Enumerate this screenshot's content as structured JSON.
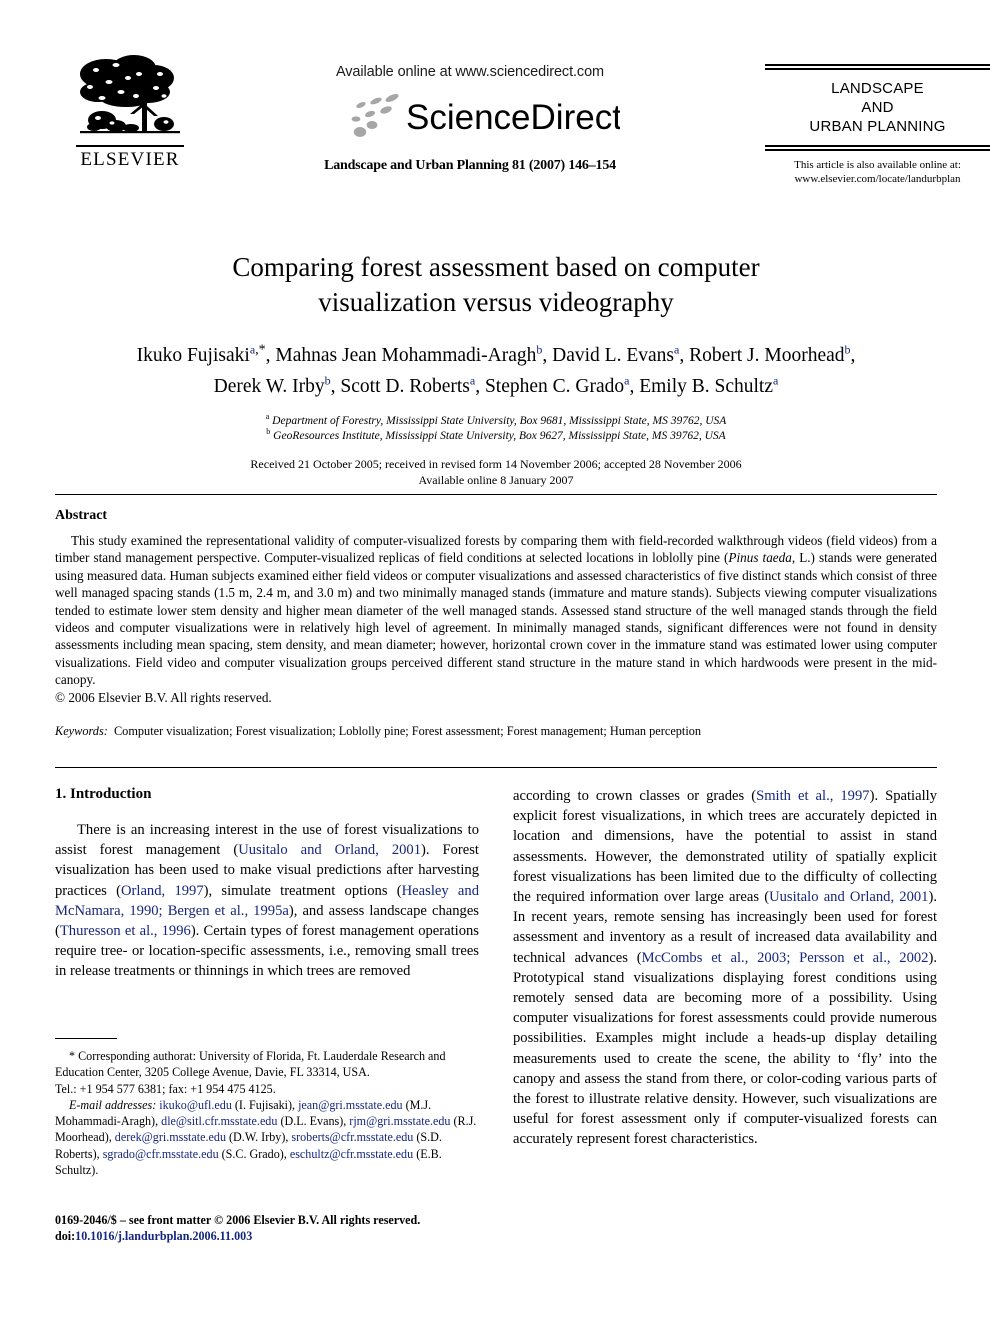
{
  "header": {
    "publisher_name": "ELSEVIER",
    "publisher_logo_icon": "elsevier-tree-icon",
    "available_online": "Available online at www.sciencedirect.com",
    "sciencedirect_wordmark": "ScienceDirect",
    "sciencedirect_logo_icon": "sciencedirect-swoosh-icon",
    "journal_citation": "Landscape and Urban Planning 81 (2007) 146–154",
    "journal_name_line1": "LANDSCAPE",
    "journal_name_line2": "AND",
    "journal_name_line3": "URBAN PLANNING",
    "also_available_label": "This article is also available online at:",
    "also_available_url": "www.elsevier.com/locate/landurbplan"
  },
  "article": {
    "title_line1": "Comparing forest assessment based on computer",
    "title_line2": "visualization versus videography",
    "authors": [
      {
        "name": "Ikuko Fujisaki",
        "aff": "a",
        "star": true
      },
      {
        "name": "Mahnas Jean Mohammadi-Aragh",
        "aff": "b"
      },
      {
        "name": "David L. Evans",
        "aff": "a"
      },
      {
        "name": "Robert J. Moorhead",
        "aff": "b"
      },
      {
        "name": "Derek W. Irby",
        "aff": "b"
      },
      {
        "name": "Scott D. Roberts",
        "aff": "a"
      },
      {
        "name": "Stephen C. Grado",
        "aff": "a"
      },
      {
        "name": "Emily B. Schultz",
        "aff": "a"
      }
    ],
    "affiliations": [
      {
        "marker": "a",
        "text": "Department of Forestry, Mississippi State University, Box 9681, Mississippi State, MS 39762, USA"
      },
      {
        "marker": "b",
        "text": "GeoResources Institute, Mississippi State University, Box 9627, Mississippi State, MS 39762, USA"
      }
    ],
    "dates_line1": "Received 21 October 2005; received in revised form 14 November 2006; accepted 28 November 2006",
    "dates_line2": "Available online 8 January 2007"
  },
  "abstract": {
    "heading": "Abstract",
    "body_part1": "This study examined the representational validity of computer-visualized forests by comparing them with field-recorded walkthrough videos (field videos) from a timber stand management perspective. Computer-visualized replicas of field conditions at selected locations in loblolly pine (",
    "body_italic": "Pinus taeda",
    "body_part2": ", L.) stands were generated using measured data. Human subjects examined either field videos or computer visualizations and assessed characteristics of five distinct stands which consist of three well managed spacing stands (1.5 m, 2.4 m, and 3.0 m) and two minimally managed stands (immature and mature stands). Subjects viewing computer visualizations tended to estimate lower stem density and higher mean diameter of the well managed stands. Assessed stand structure of the well managed stands through the field videos and computer visualizations were in relatively high level of agreement. In minimally managed stands, significant differences were not found in density assessments including mean spacing, stem density, and mean diameter; however, horizontal crown cover in the immature stand was estimated lower using computer visualizations. Field video and computer visualization groups perceived different stand structure in the mature stand in which hardwoods were present in the mid-canopy.",
    "copyright": "© 2006 Elsevier B.V. All rights reserved.",
    "keywords_label": "Keywords:",
    "keywords_value": "Computer visualization; Forest visualization; Loblolly pine; Forest assessment; Forest management; Human perception"
  },
  "introduction": {
    "heading": "1. Introduction",
    "left_p1_a": "There is an increasing interest in the use of forest visualizations to assist forest management (",
    "left_cite1": "Uusitalo and Orland, 2001",
    "left_p1_b": "). Forest visualization has been used to make visual predictions after harvesting practices (",
    "left_cite2": "Orland, 1997",
    "left_p1_c": "), simulate treatment options (",
    "left_cite3": "Heasley and McNamara, 1990; Bergen et al., 1995a",
    "left_p1_d": "), and assess landscape changes (",
    "left_cite4": "Thuresson et al., 1996",
    "left_p1_e": "). Certain types of forest management operations require tree- or location-specific assessments, i.e., removing small trees in release treatments or thinnings in which trees are removed",
    "right_p1_a": "according to crown classes or grades (",
    "right_cite1": "Smith et al., 1997",
    "right_p1_b": "). Spatially explicit forest visualizations, in which trees are accurately depicted in location and dimensions, have the potential to assist in stand assessments. However, the demonstrated utility of spatially explicit forest visualizations has been limited due to the difficulty of collecting the required information over large areas (",
    "right_cite2": "Uusitalo and Orland, 2001",
    "right_p1_c": "). In recent years, remote sensing has increasingly been used for forest assessment and inventory as a result of increased data availability and technical advances (",
    "right_cite3": "McCombs et al., 2003; Persson et al., 2002",
    "right_p1_d": "). Prototypical stand visualizations displaying forest conditions using remotely sensed data are becoming more of a possibility. Using computer visualizations for forest assessments could provide numerous possibilities. Examples might include a heads-up display detailing measurements used to create the scene, the ability to ‘fly’ into the canopy and assess the stand from there, or color-coding various parts of the forest to illustrate relative density. However, such visualizations are useful for forest assessment only if computer-visualized forests can accurately represent forest characteristics."
  },
  "footnote": {
    "star": "*",
    "corresponding_text": "Corresponding authorat: University of Florida, Ft. Lauderdale Research and Education Center, 3205 College Avenue, Davie, FL 33314, USA.",
    "tel_fax": "Tel.: +1 954 577 6381; fax: +1 954 475 4125.",
    "email_label": "E-mail addresses:",
    "emails": [
      {
        "address": "ikuko@ufl.edu",
        "owner": "(I. Fujisaki)"
      },
      {
        "address": "jean@gri.msstate.edu",
        "owner": "(M.J. Mohammadi-Aragh)"
      },
      {
        "address": "dle@sitl.cfr.msstate.edu",
        "owner": "(D.L. Evans)"
      },
      {
        "address": "rjm@gri.msstate.edu",
        "owner": "(R.J. Moorhead)"
      },
      {
        "address": "derek@gri.msstate.edu",
        "owner": "(D.W. Irby)"
      },
      {
        "address": "sroberts@cfr.msstate.edu",
        "owner": "(S.D. Roberts)"
      },
      {
        "address": "sgrado@cfr.msstate.edu",
        "owner": "(S.C. Grado)"
      },
      {
        "address": "eschultz@cfr.msstate.edu",
        "owner": "(E.B. Schultz)"
      }
    ]
  },
  "footer": {
    "issn_line": "0169-2046/$ – see front matter © 2006 Elsevier B.V. All rights reserved.",
    "doi_prefix": "doi:",
    "doi_value": "10.1016/j.landurbplan.2006.11.003"
  },
  "colors": {
    "link_blue": "#15267e",
    "text_black": "#000000",
    "page_background": "#ffffff"
  }
}
